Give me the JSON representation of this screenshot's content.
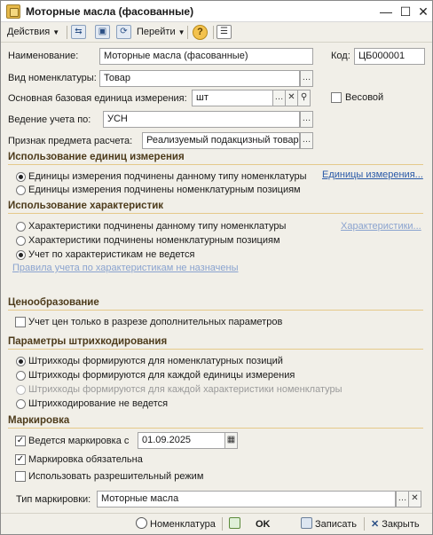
{
  "window": {
    "title": "Моторные масла (фасованные)",
    "controls": {
      "minimize": "—",
      "maximize": "☐",
      "close": "✕"
    }
  },
  "toolbar": {
    "actions": "Действия",
    "goto": "Перейти",
    "help": "?"
  },
  "form": {
    "name_label": "Наименование:",
    "name_value": "Моторные масла (фасованные)",
    "code_label": "Код:",
    "code_value": "ЦБ000001",
    "kind_label": "Вид номенклатуры:",
    "kind_value": "Товар",
    "unit_label": "Основная базовая единица измерения:",
    "unit_value": "шт",
    "weight_label": "Весовой",
    "weight_checked": false,
    "accounting_label": "Ведение учета по:",
    "accounting_value": "УСН",
    "subject_label": "Признак предмета расчета:",
    "subject_value": "Реализуемый подакцизный товар"
  },
  "units_section": {
    "title": "Использование единиц измерения",
    "options": [
      {
        "label": "Единицы измерения подчинены данному типу номенклатуры",
        "selected": true
      },
      {
        "label": "Единицы измерения подчинены номенклатурным позициям",
        "selected": false
      }
    ],
    "link": "Единицы измерения..."
  },
  "characteristics_section": {
    "title": "Использование характеристик",
    "options": [
      {
        "label": "Характеристики подчинены данному типу номенклатуры",
        "selected": false
      },
      {
        "label": "Характеристики подчинены номенклатурным позициям",
        "selected": false
      },
      {
        "label": "Учет по характеристикам не ведется",
        "selected": true
      }
    ],
    "link": "Характеристики...",
    "rules_link": "Правила учета по характеристикам не назначены"
  },
  "pricing_section": {
    "title": "Ценообразование",
    "checkbox_label": "Учет цен только в разрезе дополнительных параметров",
    "checked": false
  },
  "barcode_section": {
    "title": "Параметры штрихкодирования",
    "options": [
      {
        "label": "Штрихкоды формируются для номенклатурных позиций",
        "selected": true,
        "disabled": false
      },
      {
        "label": "Штрихкоды формируются для каждой единицы измерения",
        "selected": false,
        "disabled": false
      },
      {
        "label": "Штрихкоды формируются для каждой характеристики номенклатуры",
        "selected": false,
        "disabled": true
      },
      {
        "label": "Штрихкодирование не ведется",
        "selected": false,
        "disabled": false
      }
    ]
  },
  "marking_section": {
    "title": "Маркировка",
    "marking_from_label": "Ведется маркировка с",
    "marking_from_checked": true,
    "marking_date": "01.09.2025",
    "mandatory_label": "Маркировка обязательна",
    "mandatory_checked": true,
    "permissive_label": "Использовать разрешительный режим",
    "permissive_checked": false,
    "type_label": "Тип маркировки:",
    "type_value": "Моторные масла"
  },
  "footer": {
    "nomenclature": "Номенклатура",
    "ok": "OK",
    "save": "Записать",
    "close": "Закрыть"
  }
}
